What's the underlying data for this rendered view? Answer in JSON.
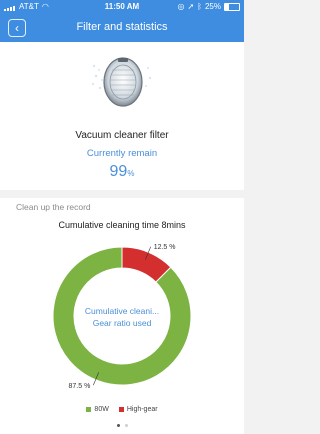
{
  "status_bar": {
    "carrier": "AT&T",
    "time": "11:50 AM",
    "battery": "25%"
  },
  "nav": {
    "back_icon": "chevron-left-icon",
    "title": "Filter and statistics"
  },
  "filter": {
    "name": "Vacuum cleaner filter",
    "remain_label": "Currently remain",
    "remain_value": "99",
    "remain_unit": "%"
  },
  "record": {
    "section_title": "Clean up the record",
    "cumulative_time": "Cumulative cleaning time  8mins"
  },
  "chart_data": {
    "type": "pie",
    "center_label_line1": "Cumulative cleani...",
    "center_label_line2": "Gear ratio used",
    "slices": [
      {
        "name": "80W",
        "value": 87.5,
        "label": "87.5 %",
        "color": "#7cb342"
      },
      {
        "name": "High-gear",
        "value": 12.5,
        "label": "12.5 %",
        "color": "#d32f2f"
      }
    ]
  },
  "pager": {
    "pages": 2,
    "active": 0
  },
  "colors": {
    "accent": "#3f8de0",
    "remain": "#4a8fd9"
  }
}
